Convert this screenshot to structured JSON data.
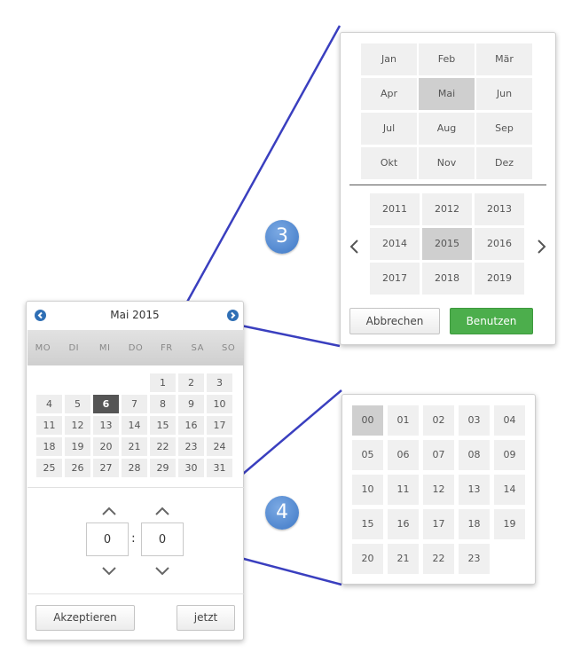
{
  "picker": {
    "title": "Mai 2015",
    "prev_icon": "‹",
    "next_icon": "›",
    "weekdays": [
      "MO",
      "DI",
      "MI",
      "DO",
      "FR",
      "SA",
      "SO"
    ],
    "weeks": [
      [
        "",
        "",
        "",
        "",
        "1",
        "2",
        "3"
      ],
      [
        "4",
        "5",
        "6",
        "7",
        "8",
        "9",
        "10"
      ],
      [
        "11",
        "12",
        "13",
        "14",
        "15",
        "16",
        "17"
      ],
      [
        "18",
        "19",
        "20",
        "21",
        "22",
        "23",
        "24"
      ],
      [
        "25",
        "26",
        "27",
        "28",
        "29",
        "30",
        "31"
      ]
    ],
    "selected_day": "6",
    "hour": "0",
    "minute": "0",
    "colon": ":",
    "accept_label": "Akzeptieren",
    "now_label": "jetzt"
  },
  "month_panel": {
    "months": [
      "Jan",
      "Feb",
      "Mär",
      "Apr",
      "Mai",
      "Jun",
      "Jul",
      "Aug",
      "Sep",
      "Okt",
      "Nov",
      "Dez"
    ],
    "selected_month": "Mai",
    "years": [
      "2011",
      "2012",
      "2013",
      "2014",
      "2015",
      "2016",
      "2017",
      "2018",
      "2019"
    ],
    "selected_year": "2015",
    "cancel_label": "Abbrechen",
    "use_label": "Benutzen"
  },
  "hour_panel": {
    "hours": [
      "00",
      "01",
      "02",
      "03",
      "04",
      "05",
      "06",
      "07",
      "08",
      "09",
      "10",
      "11",
      "12",
      "13",
      "14",
      "15",
      "16",
      "17",
      "18",
      "19",
      "20",
      "21",
      "22",
      "23"
    ],
    "selected_hour": "00"
  },
  "badges": {
    "step3": "3",
    "step4": "4"
  },
  "colors": {
    "accent_blue": "#2f6fb5",
    "connector": "#3a3fbf",
    "green": "#4cae4c",
    "selected_dark": "#555555"
  }
}
